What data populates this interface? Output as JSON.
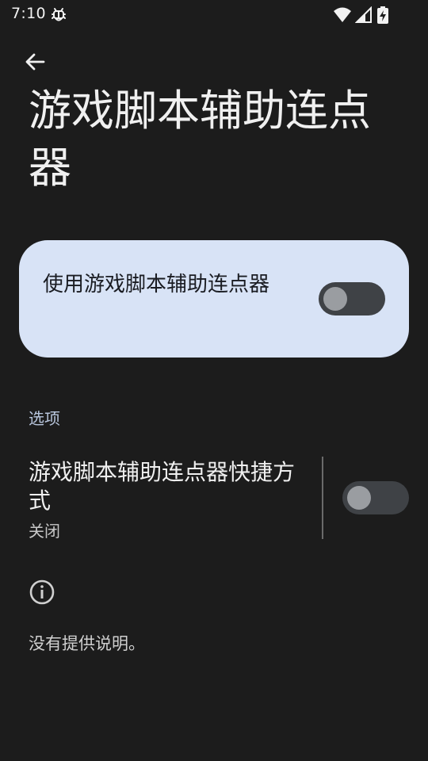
{
  "status_bar": {
    "time": "7:10",
    "notification_icon": "bug-icon",
    "wifi_icon": "wifi-icon",
    "signal_icon": "signal-icon",
    "battery_icon": "battery-charging-icon"
  },
  "header": {
    "back_icon": "arrow-back-icon",
    "title": "游戏脚本辅助连点器"
  },
  "main_toggle": {
    "label": "使用游戏脚本辅助连点器",
    "enabled": false
  },
  "options_section": {
    "header": "选项",
    "shortcut": {
      "title": "游戏脚本辅助连点器快捷方式",
      "summary": "关闭",
      "enabled": false
    }
  },
  "info": {
    "icon": "info-icon",
    "description": "没有提供说明。"
  },
  "colors": {
    "background": "#1c1c1c",
    "card_background": "#d8e3f6",
    "section_header": "#b8c6dd",
    "switch_track_off": "#3f4246",
    "switch_thumb_off": "#9a9da1"
  }
}
